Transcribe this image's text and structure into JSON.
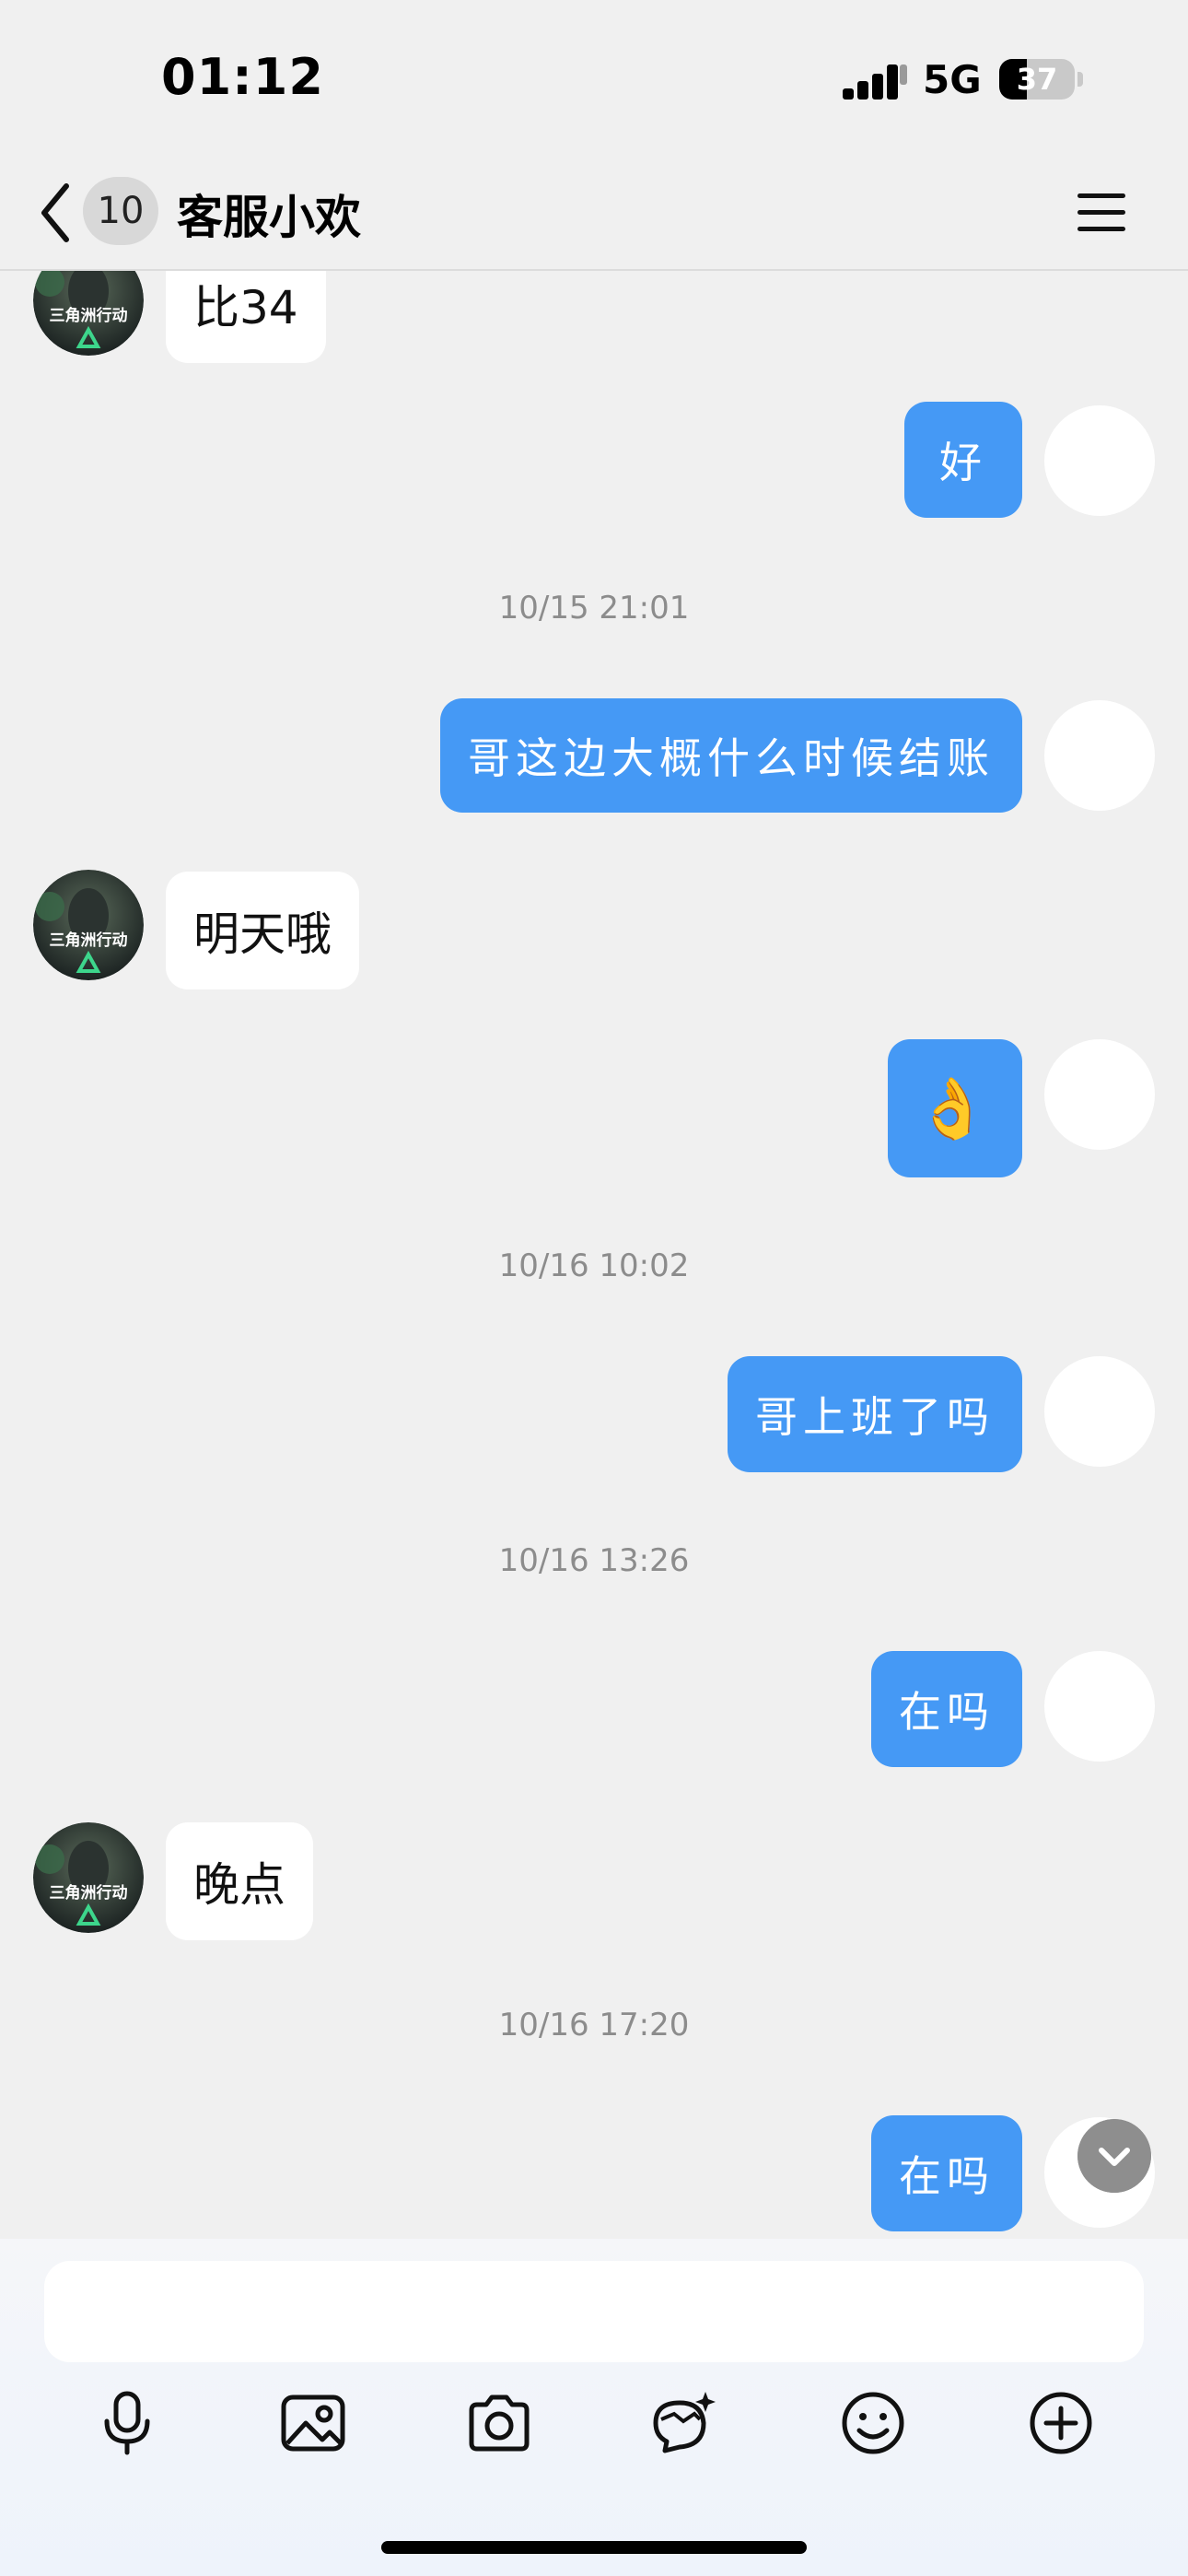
{
  "status": {
    "time": "01:12",
    "network": "5G",
    "battery": "37",
    "battery_level": 0.37
  },
  "header": {
    "unread_count": "10",
    "title": "客服小欢"
  },
  "messages": [
    {
      "side": "in",
      "text": "比34"
    },
    {
      "side": "out",
      "text": "好"
    },
    {
      "side": "time",
      "text": "10/15 21:01"
    },
    {
      "side": "out",
      "text": "哥这边大概什么时候结账"
    },
    {
      "side": "in",
      "text": "明天哦"
    },
    {
      "side": "out",
      "text": "👌"
    },
    {
      "side": "time",
      "text": "10/16 10:02"
    },
    {
      "side": "out",
      "text": "哥上班了吗"
    },
    {
      "side": "time",
      "text": "10/16 13:26"
    },
    {
      "side": "out",
      "text": "在吗"
    },
    {
      "side": "in",
      "text": "晚点"
    },
    {
      "side": "time",
      "text": "10/16 17:20"
    },
    {
      "side": "out",
      "text": "在吗"
    }
  ],
  "avatar": {
    "caption": "三角洲行动"
  },
  "input": {
    "placeholder": ""
  },
  "toolbar": [
    "microphone-icon",
    "image-icon",
    "camera-icon",
    "sticker-icon",
    "emoji-icon",
    "plus-icon"
  ],
  "colors": {
    "outgoing_bubble": "#4599f5",
    "incoming_bubble": "#ffffff",
    "background": "#f0f0f0"
  }
}
